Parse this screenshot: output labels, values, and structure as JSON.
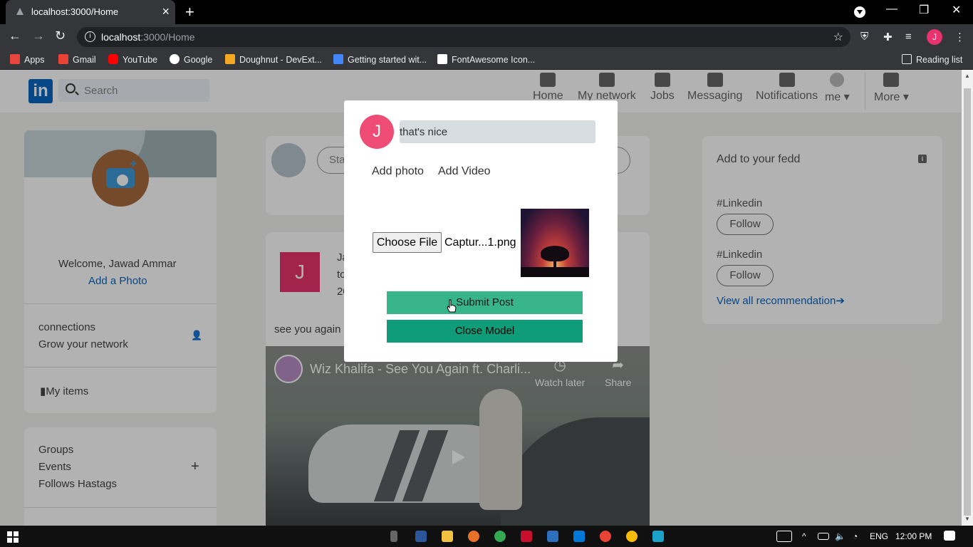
{
  "browser": {
    "tab_title": "localhost:3000/Home",
    "url_host": "localhost",
    "url_rest": ":3000/Home",
    "bookmarks": [
      "Apps",
      "Gmail",
      "YouTube",
      "Google",
      "Doughnut - DevExt...",
      "Getting started wit...",
      "FontAwesome Icon..."
    ],
    "reading_list": "Reading list",
    "profile_initial": "J"
  },
  "header": {
    "logo": "in",
    "search_placeholder": "Search",
    "nav": [
      "Home",
      "My network",
      "Jobs",
      "Messaging",
      "Notifications",
      "me",
      "More"
    ]
  },
  "left": {
    "welcome": "Welcome, Jawad Ammar",
    "add_photo": "Add a Photo",
    "connections": "connections",
    "grow": "Grow your network",
    "my_items": "My items",
    "groups": "Groups",
    "events": "Events",
    "hashtags": "Follows Hastags"
  },
  "feed": {
    "start_post": "Start",
    "article_initial": "J",
    "article_meta": [
      "Ja",
      "to",
      "20"
    ],
    "article_desc": "see you again",
    "video_title": "Wiz Khalifa - See You Again ft. Charli...",
    "watch_later": "Watch later",
    "share": "Share"
  },
  "right": {
    "title": "Add to your fedd",
    "tag1": "#Linkedin",
    "tag2": "#Linkedin",
    "follow": "Follow",
    "view_all": "View all recommendation"
  },
  "modal": {
    "avatar_initial": "J",
    "input_value": "that's nice",
    "add_photo": "Add photo",
    "add_video": "Add Video",
    "choose_file": "Choose File",
    "file_name": "Captur...1.png",
    "submit": "Submit Post",
    "close": "Close Model"
  },
  "taskbar": {
    "lang": "ENG",
    "time": "12:00 PM"
  },
  "colors": {
    "linkedin_blue": "#0a66c2",
    "avatar_pink": "#ee4c75",
    "submit_green": "#38b48b",
    "close_green": "#0e9d78"
  }
}
